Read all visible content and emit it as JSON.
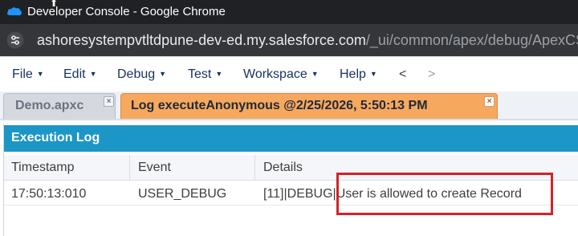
{
  "window": {
    "title": "Developer Console - Google Chrome",
    "icon": "salesforce-cloud-icon",
    "colors": {
      "titlebar": "#202124",
      "addressbar": "#35363a"
    }
  },
  "address_bar": {
    "site_info_icon": "tune-icon",
    "url_domain": "ashoresystempvtltdpune-dev-ed.my.salesforce.com",
    "url_path": "/_ui/common/apex/debug/ApexCSIP"
  },
  "menu": {
    "items": [
      {
        "label": "File"
      },
      {
        "label": "Edit"
      },
      {
        "label": "Debug"
      },
      {
        "label": "Test"
      },
      {
        "label": "Workspace"
      },
      {
        "label": "Help"
      }
    ],
    "back_label": "<",
    "forward_label": ">"
  },
  "tabs": [
    {
      "label": "Demo.apxc",
      "active": false,
      "close_label": "×"
    },
    {
      "label": "Log executeAnonymous @2/25/2026, 5:50:13 PM",
      "active": true,
      "close_label": "×"
    }
  ],
  "execution_log": {
    "title": "Execution Log",
    "columns": [
      "Timestamp",
      "Event",
      "Details"
    ],
    "rows": [
      {
        "timestamp": "17:50:13:010",
        "event": "USER_DEBUG",
        "details_prefix": "[11]|DEBUG|",
        "details_message": "User is allowed to create Record"
      }
    ],
    "colors": {
      "header": "#1b96c6",
      "highlight_box": "#d2232a",
      "active_tab": "#f6a85f"
    }
  }
}
